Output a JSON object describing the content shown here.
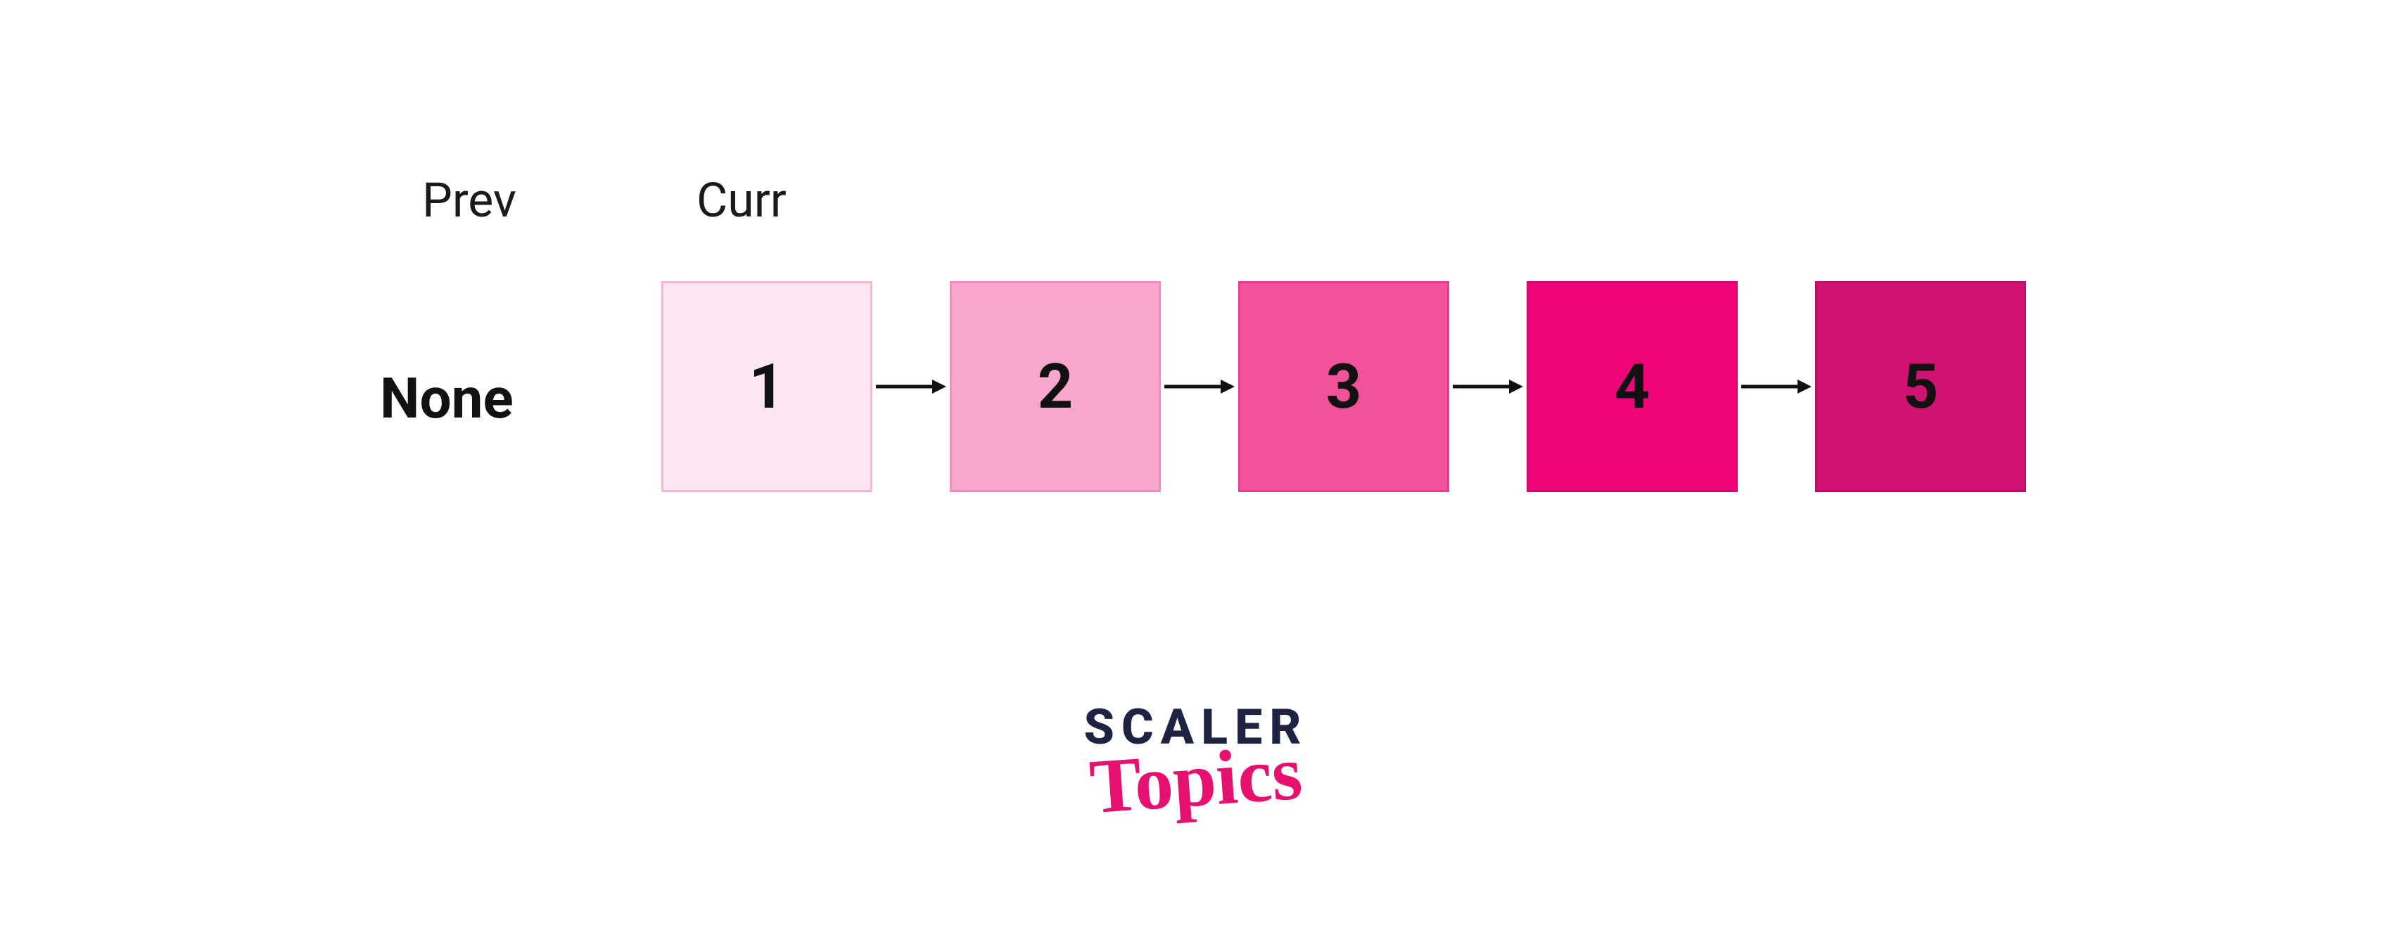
{
  "labels": {
    "prev": "Prev",
    "curr": "Curr",
    "none": "None"
  },
  "nodes": [
    {
      "value": "1",
      "fill": "#fde6f1",
      "border": "#f6b8d5"
    },
    {
      "value": "2",
      "fill": "#f9a7cd",
      "border": "#f48bbd"
    },
    {
      "value": "3",
      "fill": "#f2519c",
      "border": "#e93d8e"
    },
    {
      "value": "4",
      "fill": "#ed0579",
      "border": "#d8046d"
    },
    {
      "value": "5",
      "fill": "#d01272",
      "border": "#ba1066"
    }
  ],
  "logo": {
    "line1": "SCALER",
    "line2": "Topics"
  }
}
